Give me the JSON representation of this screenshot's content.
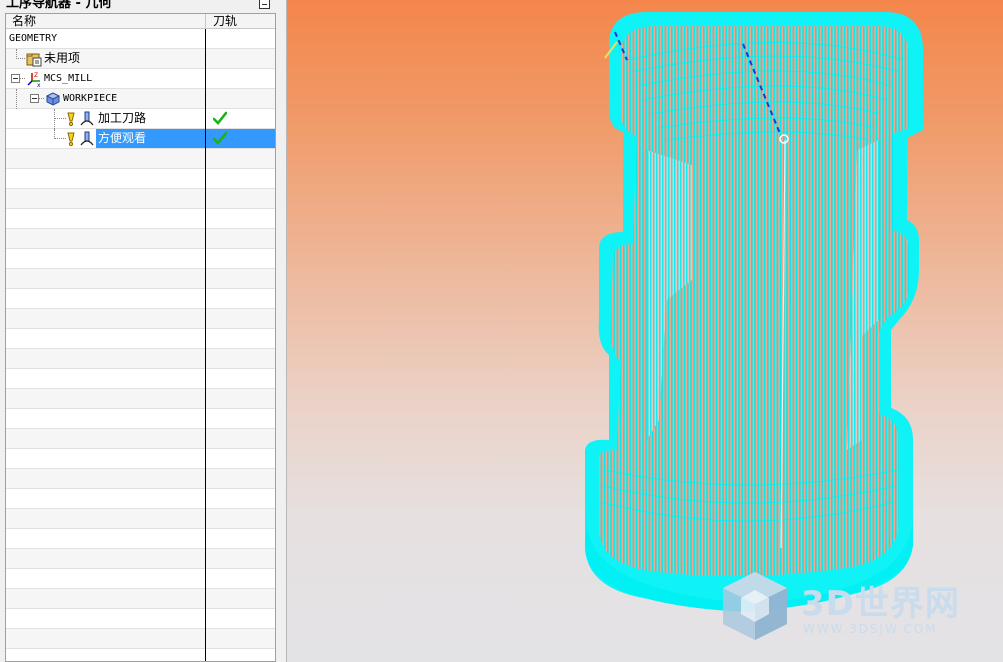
{
  "panel": {
    "title": "工序导航器 - 几何",
    "columns": {
      "name": "名称",
      "path": "刀轨"
    }
  },
  "tree": [
    {
      "label": "GEOMETRY",
      "icon": "none",
      "path_ok": false
    },
    {
      "label": "未用项",
      "icon": "unused-folder-icon",
      "path_ok": false
    },
    {
      "label": "MCS_MILL",
      "icon": "mcs-axis-icon",
      "path_ok": false
    },
    {
      "label": "WORKPIECE",
      "icon": "workpiece-icon",
      "path_ok": false
    },
    {
      "label": "加工刀路",
      "icon": "cavity-mill-operation-icon",
      "path_ok": true
    },
    {
      "label": "方便观看",
      "icon": "cavity-mill-operation-icon",
      "path_ok": true,
      "selected": true
    }
  ],
  "watermark": {
    "brand": "3D世界网",
    "url": "WWW.3DSJW.COM"
  },
  "colors": {
    "toolpath": "#00ffff",
    "selection": "#3399ff",
    "check": "#1bb21b",
    "background_top": "#f4864b",
    "background_bottom": "#e3e3e6"
  }
}
